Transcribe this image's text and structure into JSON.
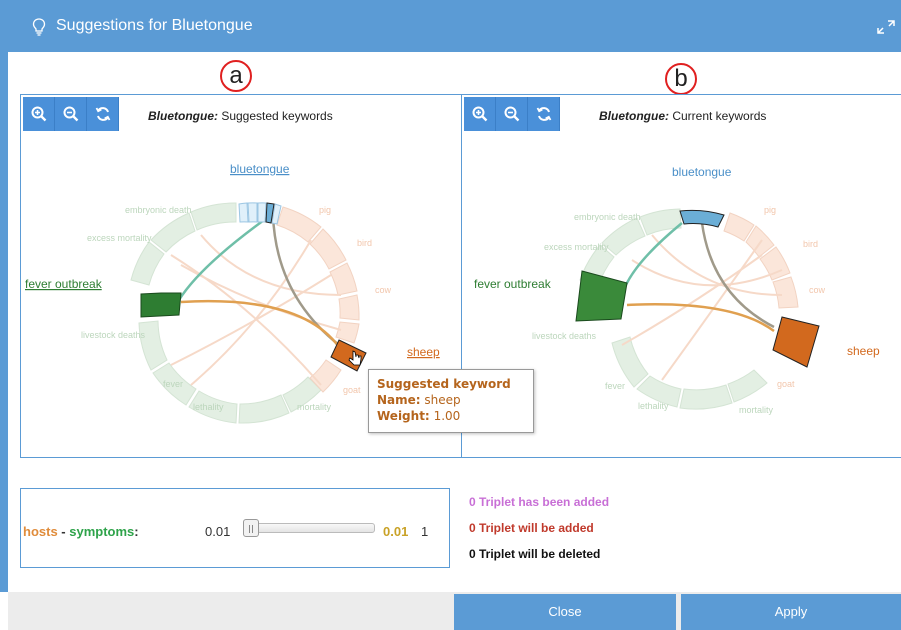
{
  "dialog": {
    "title": "Suggestions for Bluetongue",
    "icon": "lightbulb-icon",
    "expand_icon": "expand-icon"
  },
  "annotations": {
    "a": "a",
    "b": "b"
  },
  "left_panel": {
    "title_bold": "Bluetongue:",
    "title_rest": " Suggested keywords",
    "labels": {
      "bluetongue": "bluetongue",
      "fever_outbreak": "fever outbreak",
      "sheep": "sheep",
      "embryonic_death": "embryonic death",
      "excess_mortality": "excess mortality",
      "livestock_deaths": "livestock deaths",
      "fever": "fever",
      "lethality": "lethality",
      "mortality": "mortality",
      "goat": "goat",
      "cow": "cow",
      "bird": "bird",
      "pig": "pig"
    }
  },
  "right_panel": {
    "title_bold": "Bluetongue:",
    "title_rest": " Current keywords",
    "labels": {
      "bluetongue": "bluetongue",
      "fever_outbreak": "fever outbreak",
      "sheep": "sheep",
      "embryonic_death": "embryonic death",
      "excess_mortality": "excess mortality",
      "livestock_deaths": "livestock deaths",
      "fever": "fever",
      "lethality": "lethality",
      "mortality": "mortality",
      "goat": "goat",
      "cow": "cow",
      "bird": "bird",
      "pig": "pig"
    }
  },
  "tooltip": {
    "heading": "Suggested keyword",
    "name_label": "Name:",
    "name_value": "sheep",
    "weight_label": "Weight:",
    "weight_value": "1.00"
  },
  "threshold": {
    "label_hosts": "hosts",
    "label_sep": " - ",
    "label_symptoms": "symptoms",
    "label_colon": ":",
    "min": "0.01",
    "current": "0.01",
    "max": "1",
    "slider_fraction": 0.0
  },
  "status": {
    "added": "0 Triplet has been added",
    "will_add": "0 Triplet will be added",
    "will_delete": "0 Triplet will be deleted"
  },
  "buttons": {
    "close": "Close",
    "apply": "Apply"
  },
  "colors": {
    "accent": "#5b9bd5",
    "host": "#d2691e",
    "symptom": "#2e7d32",
    "disease": "#6baed6",
    "faded_green": "#e3efe3",
    "faded_orange": "#fbe6da"
  }
}
